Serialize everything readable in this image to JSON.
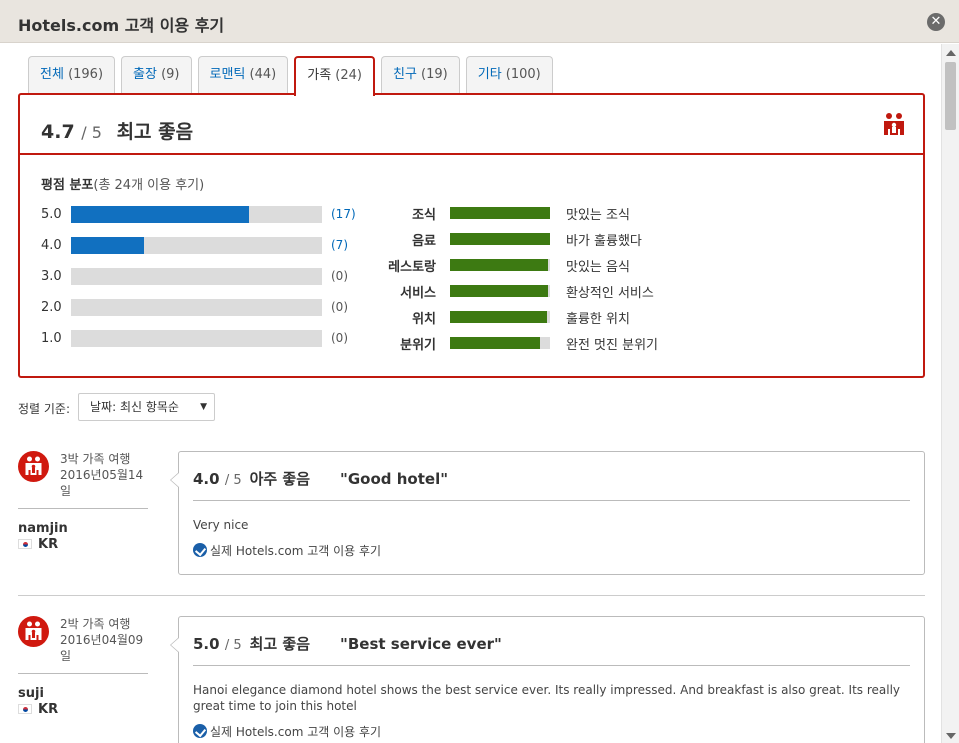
{
  "window": {
    "title": "Hotels.com 고객 이용 후기",
    "close_label": "✕"
  },
  "tabs": [
    {
      "label": "전체",
      "count": "(196)"
    },
    {
      "label": "출장",
      "count": "(9)"
    },
    {
      "label": "로맨틱",
      "count": "(44)"
    },
    {
      "label": "가족",
      "count": "(24)",
      "active": true
    },
    {
      "label": "친구",
      "count": "(19)"
    },
    {
      "label": "기타",
      "count": "(100)"
    }
  ],
  "summary": {
    "score": "4.7",
    "out_of": "/ 5",
    "rating_word": "최고 좋음",
    "dist_title": "평점 분포",
    "dist_subtitle": "(총 24개 이용 후기)",
    "distribution": [
      {
        "label": "5.0",
        "count": 17,
        "count_text": "(17)"
      },
      {
        "label": "4.0",
        "count": 7,
        "count_text": "(7)"
      },
      {
        "label": "3.0",
        "count": 0,
        "count_text": "(0)"
      },
      {
        "label": "2.0",
        "count": 0,
        "count_text": "(0)"
      },
      {
        "label": "1.0",
        "count": 0,
        "count_text": "(0)"
      }
    ],
    "categories": [
      {
        "name": "조식",
        "level": 1.0,
        "desc": "맛있는 조식"
      },
      {
        "name": "음료",
        "level": 1.0,
        "desc": "바가 훌륭했다"
      },
      {
        "name": "레스토랑",
        "level": 0.98,
        "desc": "맛있는 음식"
      },
      {
        "name": "서비스",
        "level": 0.98,
        "desc": "환상적인 서비스"
      },
      {
        "name": "위치",
        "level": 0.97,
        "desc": "훌륭한 위치"
      },
      {
        "name": "분위기",
        "level": 0.9,
        "desc": "완전 멋진 분위기"
      }
    ],
    "colors": {
      "accent_red": "#c0190f",
      "bar_blue": "#1170c0",
      "bar_green": "#3d7a12"
    }
  },
  "sort": {
    "label": "정렬 기준:",
    "selected": "날짜: 최신 항목순"
  },
  "reviews": [
    {
      "trip_type": "3박 가족 여행",
      "date": "2016년05월14일",
      "user": "namjin",
      "country": "KR",
      "score": "4.0",
      "out_of": "/ 5",
      "rating_word": "아주 좋음",
      "title": "\"Good hotel\"",
      "body": "Very nice",
      "verified": "실제 Hotels.com 고객 이용 후기"
    },
    {
      "trip_type": "2박 가족 여행",
      "date": "2016년04월09일",
      "user": "suji",
      "country": "KR",
      "score": "5.0",
      "out_of": "/ 5",
      "rating_word": "최고 좋음",
      "title": "\"Best service ever\"",
      "body": "Hanoi elegance diamond hotel shows the best service ever. Its really impressed. And breakfast is also great. Its really great time to join this hotel",
      "verified": "실제 Hotels.com 고객 이용 후기"
    }
  ]
}
